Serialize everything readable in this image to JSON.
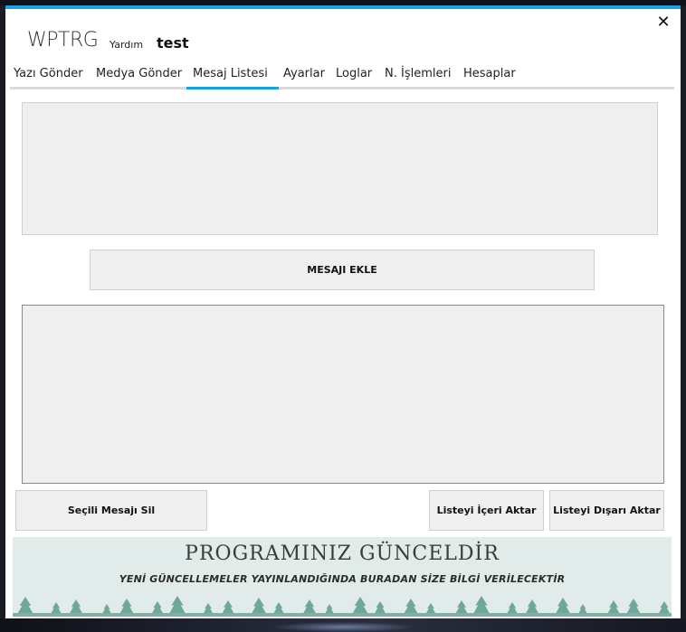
{
  "app": {
    "title": "WPTRG",
    "help_label": "Yardım",
    "user_label": "test",
    "close_glyph": "✕"
  },
  "tabs": [
    {
      "label": "Yazı Gönder"
    },
    {
      "label": "Medya Gönder"
    },
    {
      "label": "Mesaj Listesi",
      "active": true
    },
    {
      "label": "Ayarlar"
    },
    {
      "label": "Loglar"
    },
    {
      "label": "N. İşlemleri"
    },
    {
      "label": "Hesaplar"
    }
  ],
  "message_input": {
    "value": ""
  },
  "buttons": {
    "add_message": "MESAJI EKLE",
    "delete_selected": "Seçili Mesajı Sil",
    "import_list": "Listeyi İçeri Aktar",
    "export_list": "Listeyi Dışarı Aktar"
  },
  "message_list": {
    "items": []
  },
  "banner": {
    "title": "PROGRAMINIZ GÜNCELDİR",
    "subtitle": "YENİ GÜNCELLEMELER YAYINLANDIĞINDA BURADAN SİZE BİLGİ VERİLECEKTİR"
  },
  "colors": {
    "accent": "#1ba1e2",
    "banner_bg": "#e1ebe9",
    "tree": "#6fa79a",
    "ground": "#7fb0a5"
  }
}
